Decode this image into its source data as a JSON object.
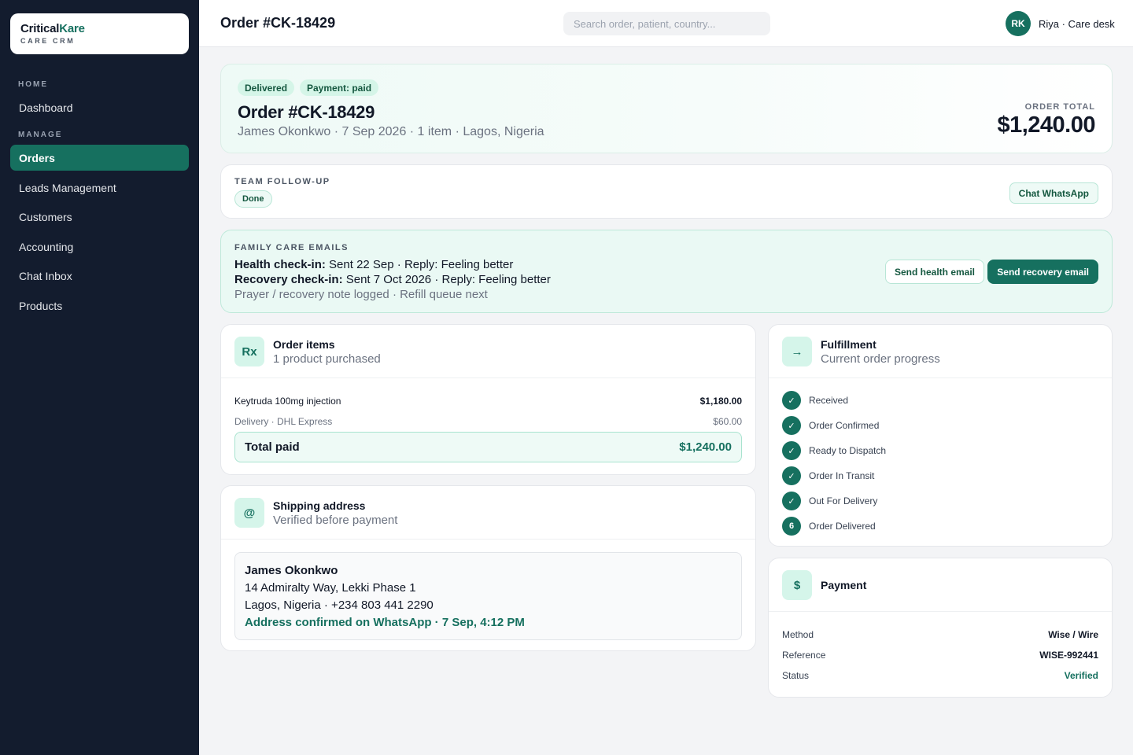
{
  "brand": {
    "name_primary": "Critical",
    "name_accent": "Kare",
    "subtitle": "CARE CRM"
  },
  "sidebar": {
    "sections": {
      "home": "HOME",
      "manage": "MANAGE"
    },
    "items": [
      {
        "label": "Dashboard"
      },
      {
        "label": "Orders"
      },
      {
        "label": "Leads Management"
      },
      {
        "label": "Customers"
      },
      {
        "label": "Accounting"
      },
      {
        "label": "Chat Inbox"
      },
      {
        "label": "Products"
      }
    ]
  },
  "header": {
    "title": "Order #CK-18429",
    "search_placeholder": "Search order, patient, country...",
    "avatar_initials": "RK",
    "user_label": "Riya · Care desk"
  },
  "summary": {
    "badge_status": "Delivered",
    "badge_payment": "Payment: paid",
    "title": "Order #CK-18429",
    "subtitle": "James Okonkwo · 7 Sep 2026 · 1 item · Lagos, Nigeria",
    "total_label": "ORDER TOTAL",
    "total_value": "$1,240.00"
  },
  "followup": {
    "label": "TEAM FOLLOW-UP",
    "status": "Done",
    "chat_button": "Chat WhatsApp"
  },
  "emails": {
    "label": "FAMILY CARE EMAILS",
    "health_label": "Health check-in:",
    "health_text": " Sent 22 Sep · Reply: Feeling better",
    "recovery_label": "Recovery check-in:",
    "recovery_text": " Sent 7 Oct 2026 · Reply: Feeling better",
    "note": "Prayer / recovery note logged · Refill queue next",
    "send_health": "Send health email",
    "send_recovery": "Send recovery email"
  },
  "order_items": {
    "icon": "Rx",
    "title": "Order items",
    "subtitle": "1 product purchased",
    "lines": [
      {
        "name": "Keytruda 100mg injection",
        "amount": "$1,180.00"
      },
      {
        "name": "Delivery · DHL Express",
        "amount": "$60.00"
      }
    ],
    "total_label": "Total paid",
    "total_value": "$1,240.00"
  },
  "shipping": {
    "icon": "@",
    "title": "Shipping address",
    "subtitle": "Verified before payment",
    "name": "James Okonkwo",
    "line1": "14 Admiralty Way, Lekki Phase 1",
    "line2": "Lagos, Nigeria · +234 803 441 2290",
    "confirmation": "Address confirmed on WhatsApp · 7 Sep, 4:12 PM"
  },
  "fulfillment": {
    "icon": "→",
    "title": "Fulfillment",
    "subtitle": "Current order progress",
    "steps": [
      {
        "marker": "✓",
        "label": "Received"
      },
      {
        "marker": "✓",
        "label": "Order Confirmed"
      },
      {
        "marker": "✓",
        "label": "Ready to Dispatch"
      },
      {
        "marker": "✓",
        "label": "Order In Transit"
      },
      {
        "marker": "✓",
        "label": "Out For Delivery"
      },
      {
        "marker": "6",
        "label": "Order Delivered"
      }
    ]
  },
  "payment": {
    "icon": "$",
    "title": "Payment",
    "rows": [
      {
        "key": "Method",
        "value": "Wise / Wire"
      },
      {
        "key": "Reference",
        "value": "WISE-992441"
      },
      {
        "key": "Status",
        "value": "Verified"
      }
    ]
  },
  "colors": {
    "brand": "#16705f",
    "sidebar": "#131c2e",
    "accent_bg": "#eaf9f4"
  }
}
